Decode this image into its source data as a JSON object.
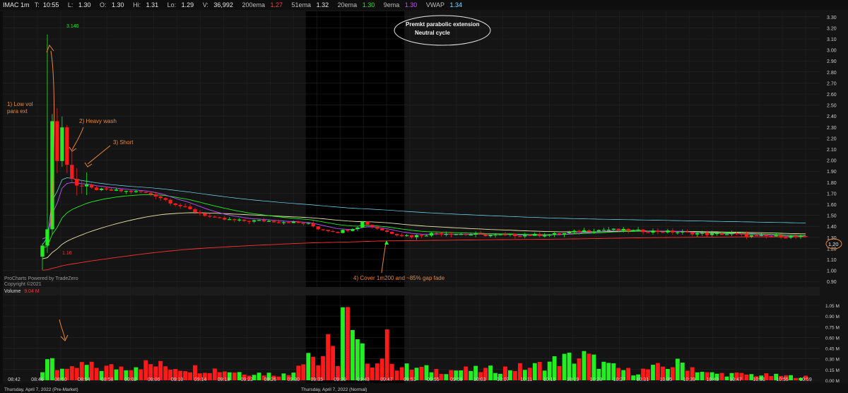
{
  "header": {
    "symbol": "IMAC 1m",
    "t_label": "T:",
    "t_value": "10:55",
    "l_label": "L:",
    "l_value": "1.30",
    "o_label": "O:",
    "o_value": "1.30",
    "hi_label": "Hi:",
    "hi_value": "1.31",
    "lo_label": "Lo:",
    "lo_value": "1.29",
    "v_label": "V:",
    "v_value": "36,992",
    "ema200_label": "200ema",
    "ema200_value": "1.27",
    "ema51_label": "51ema",
    "ema51_value": "1.32",
    "ema20_label": "20ema",
    "ema20_value": "1.30",
    "ema9_label": "9ema",
    "ema9_value": "1.30",
    "vwap_label": "VWAP",
    "vwap_value": "1.34"
  },
  "volume_panel": {
    "label": "Volume",
    "value": "9.04 M"
  },
  "watermark": {
    "line1": "ProCharts Powered by TradeZero",
    "line2": "Copyright ©2021"
  },
  "date_labels": {
    "premarket": "Thursday, April 7, 2022 (Pre-Market)",
    "normal": "Thursday, April 7, 2022 (Normal)"
  },
  "current_price_label": "1.20",
  "colors": {
    "up": "#22ee22",
    "down": "#ff1a1a",
    "background": "#141414",
    "regular_session": "#000000",
    "ema9": "#c24dff",
    "ema20": "#22ee22",
    "ema51": "#e8e6a8",
    "ema200": "#ff3030",
    "vwap": "#6fe2ff",
    "annotation": "#e8873a"
  },
  "annotations": [
    {
      "id": "low-vol",
      "lines": [
        "1) Low vol",
        "para ext"
      ]
    },
    {
      "id": "heavy-wash",
      "lines": [
        "2) Heavy wash"
      ]
    },
    {
      "id": "short",
      "lines": [
        "3) Short"
      ]
    },
    {
      "id": "cover",
      "lines": [
        "4) Cover 1m200 and ~85% gap fade"
      ]
    },
    {
      "id": "bubble",
      "lines": [
        "Premkt parabolic extension",
        "Neutral cycle"
      ]
    }
  ],
  "chart_data": {
    "type": "candlestick",
    "timeframe": "1m",
    "y_ticks": [
      "3.30",
      "3.20",
      "3.10",
      "3.00",
      "2.90",
      "2.80",
      "2.70",
      "2.60",
      "2.50",
      "2.40",
      "2.30",
      "2.20",
      "2.10",
      "2.00",
      "1.90",
      "1.80",
      "1.70",
      "1.60",
      "1.50",
      "1.40",
      "1.30",
      "1.20",
      "1.10",
      "1.00",
      "0.90"
    ],
    "ylim": [
      0.85,
      3.35
    ],
    "volume_ticks": [
      "1.05 M",
      "0.90 M",
      "0.75 M",
      "0.60 M",
      "0.45 M",
      "0.30 M",
      "0.15 M",
      "0.00 M"
    ],
    "volume_ylim": [
      0,
      1.05
    ],
    "x_ticks": [
      "08:42",
      "08:46",
      "08:50",
      "08:54",
      "08:58",
      "09:02",
      "09:06",
      "09:10",
      "09:14",
      "09:18",
      "09:22",
      "09:26",
      "09:30",
      "09:35",
      "09:39",
      "09:43",
      "09:47",
      "09:51",
      "09:55",
      "09:59",
      "10:03",
      "10:07",
      "10:11",
      "10:15",
      "10:19",
      "10:23",
      "10:27",
      "10:31",
      "10:35",
      "10:39",
      "10:43",
      "10:47",
      "10:51",
      "10:55",
      "10:59"
    ],
    "premarket_high_label": "3.140",
    "premarket_low_label": "1.16",
    "price_path": [
      [
        0,
        1.2
      ],
      [
        1,
        1.4
      ],
      [
        2,
        2.35
      ],
      [
        3,
        2.0
      ],
      [
        4,
        2.3
      ],
      [
        5,
        1.95
      ],
      [
        6,
        1.85
      ],
      [
        7,
        1.78
      ],
      [
        8,
        1.76
      ],
      [
        9,
        1.75
      ],
      [
        12,
        1.73
      ],
      [
        16,
        1.72
      ],
      [
        20,
        1.71
      ],
      [
        23,
        1.68
      ],
      [
        26,
        1.62
      ],
      [
        30,
        1.55
      ],
      [
        35,
        1.47
      ],
      [
        40,
        1.45
      ],
      [
        45,
        1.45
      ],
      [
        50,
        1.44
      ],
      [
        54,
        1.42
      ],
      [
        56,
        1.38
      ],
      [
        60,
        1.35
      ],
      [
        62,
        1.37
      ],
      [
        64,
        1.4
      ],
      [
        65,
        1.44
      ],
      [
        67,
        1.4
      ],
      [
        70,
        1.35
      ],
      [
        72,
        1.33
      ],
      [
        75,
        1.31
      ],
      [
        80,
        1.34
      ],
      [
        90,
        1.32
      ],
      [
        100,
        1.32
      ],
      [
        105,
        1.33
      ],
      [
        110,
        1.36
      ],
      [
        115,
        1.37
      ],
      [
        120,
        1.36
      ],
      [
        128,
        1.35
      ],
      [
        135,
        1.33
      ],
      [
        140,
        1.33
      ],
      [
        145,
        1.31
      ],
      [
        150,
        1.31
      ],
      [
        155,
        1.3
      ]
    ],
    "volume_path": [
      [
        0,
        0.1
      ],
      [
        1,
        0.38
      ],
      [
        2,
        0.35
      ],
      [
        3,
        0.2
      ],
      [
        5,
        0.12
      ],
      [
        8,
        0.22
      ],
      [
        12,
        0.18
      ],
      [
        16,
        0.2
      ],
      [
        20,
        0.24
      ],
      [
        25,
        0.21
      ],
      [
        30,
        0.18
      ],
      [
        35,
        0.16
      ],
      [
        40,
        0.12
      ],
      [
        45,
        0.1
      ],
      [
        50,
        0.08
      ],
      [
        54,
        0.45
      ],
      [
        56,
        0.25
      ],
      [
        58,
        0.5
      ],
      [
        60,
        0.3
      ],
      [
        61,
        1.05
      ],
      [
        62,
        0.9
      ],
      [
        63,
        0.6
      ],
      [
        65,
        0.4
      ],
      [
        68,
        0.25
      ],
      [
        70,
        0.55
      ],
      [
        72,
        0.2
      ],
      [
        75,
        0.18
      ],
      [
        80,
        0.15
      ],
      [
        90,
        0.15
      ],
      [
        100,
        0.2
      ],
      [
        105,
        0.3
      ],
      [
        110,
        0.35
      ],
      [
        115,
        0.2
      ],
      [
        120,
        0.12
      ],
      [
        130,
        0.25
      ],
      [
        135,
        0.1
      ],
      [
        145,
        0.08
      ],
      [
        155,
        0.05
      ]
    ],
    "session_boundaries": {
      "regular_open_bar": 54,
      "shade_end_bar": 74
    },
    "bar_count": 156
  }
}
